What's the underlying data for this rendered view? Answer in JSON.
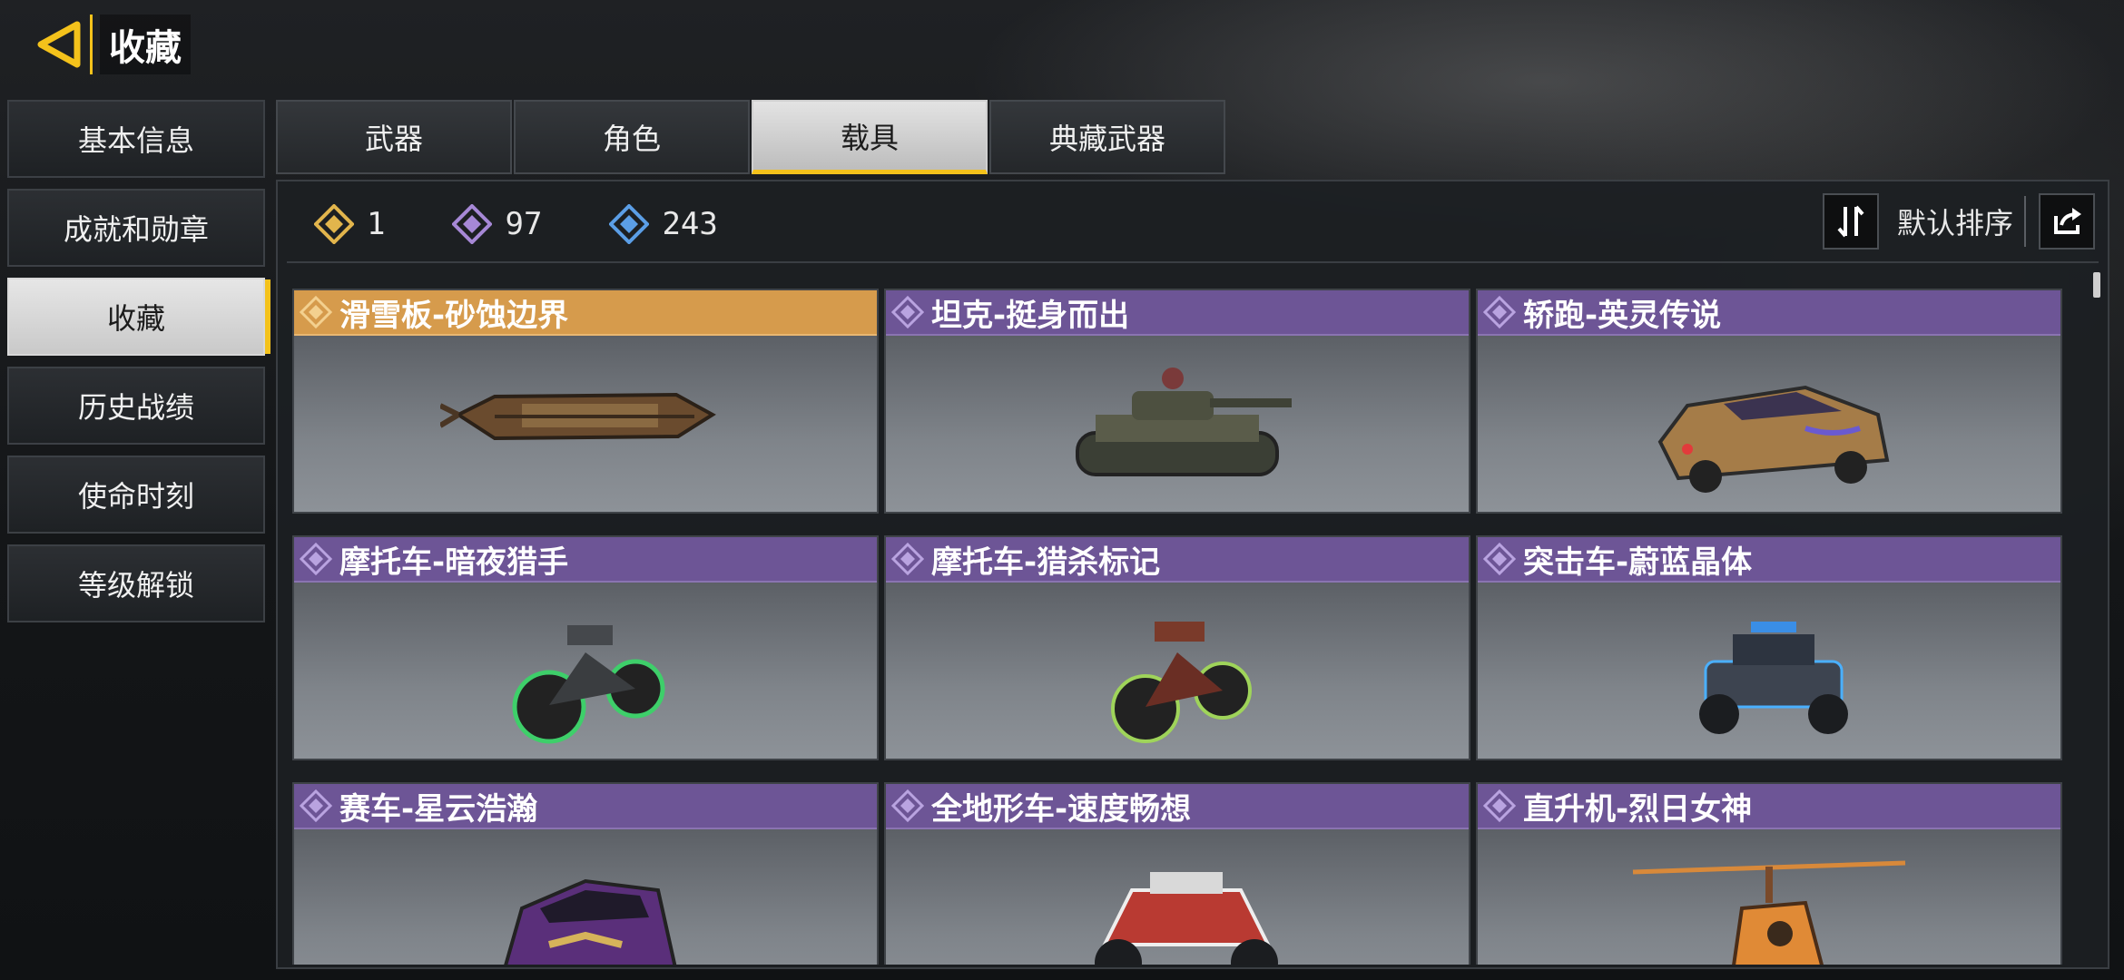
{
  "header": {
    "title": "收藏"
  },
  "sidebar": {
    "items": [
      {
        "label": "基本信息"
      },
      {
        "label": "成就和勋章"
      },
      {
        "label": "收藏"
      },
      {
        "label": "历史战绩"
      },
      {
        "label": "使命时刻"
      },
      {
        "label": "等级解锁"
      }
    ]
  },
  "tabs": [
    {
      "label": "武器"
    },
    {
      "label": "角色"
    },
    {
      "label": "载具"
    },
    {
      "label": "典藏武器"
    }
  ],
  "stats": [
    {
      "count": "1",
      "color": "#e2b54c"
    },
    {
      "count": "97",
      "color": "#a688d6"
    },
    {
      "count": "243",
      "color": "#5b9ee6"
    }
  ],
  "sort": {
    "label": "默认排序"
  },
  "vehicles": [
    {
      "name": "滑雪板-砂蚀边界",
      "rarity": "legendary",
      "icon": "hoverboard-image"
    },
    {
      "name": "坦克-挺身而出",
      "rarity": "epic",
      "icon": "tank-image"
    },
    {
      "name": "轿跑-英灵传说",
      "rarity": "epic",
      "icon": "coupe-image"
    },
    {
      "name": "摩托车-暗夜猎手",
      "rarity": "epic",
      "icon": "motorcycle-image"
    },
    {
      "name": "摩托车-猎杀标记",
      "rarity": "epic",
      "icon": "motorcycle-image"
    },
    {
      "name": "突击车-蔚蓝晶体",
      "rarity": "epic",
      "icon": "assault-vehicle-image"
    },
    {
      "name": "赛车-星云浩瀚",
      "rarity": "epic",
      "icon": "race-car-image"
    },
    {
      "name": "全地形车-速度畅想",
      "rarity": "epic",
      "icon": "atv-image"
    },
    {
      "name": "直升机-烈日女神",
      "rarity": "epic",
      "icon": "helicopter-image"
    }
  ],
  "colors": {
    "accent": "#f4c21b",
    "legendary": "#d69b4c",
    "epic": "#6d5596"
  }
}
